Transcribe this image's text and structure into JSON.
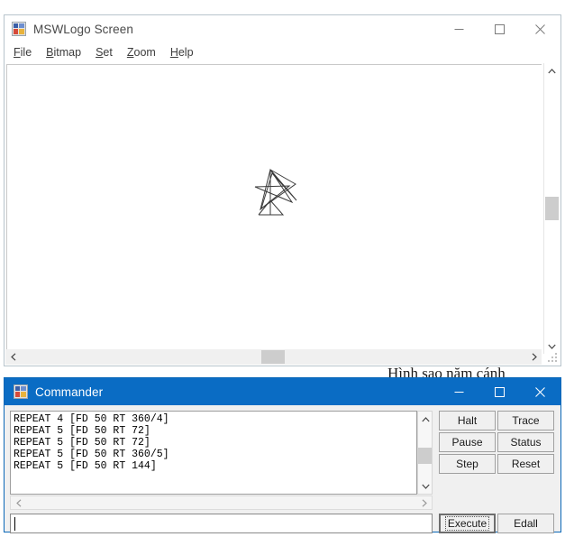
{
  "main_window": {
    "icon": "mswlogo-icon",
    "title": "MSWLogo Screen",
    "menu": [
      {
        "accel": "F",
        "rest": "ile",
        "name": "file"
      },
      {
        "accel": "B",
        "rest": "itmap",
        "name": "bitmap"
      },
      {
        "accel": "S",
        "rest": "et",
        "name": "set"
      },
      {
        "accel": "Z",
        "rest": "oom",
        "name": "zoom"
      },
      {
        "accel": "H",
        "rest": "elp",
        "name": "help"
      }
    ],
    "controls": {
      "minimize": "minimize-icon",
      "maximize": "maximize-icon",
      "close": "close-icon"
    }
  },
  "background_note": "Hình sao năm cánh",
  "commander": {
    "icon": "mswlogo-icon",
    "title": "Commander",
    "controls": {
      "minimize": "minimize-icon",
      "maximize": "maximize-icon",
      "close": "close-icon"
    },
    "history": "REPEAT 4 [FD 50 RT 360/4]\nREPEAT 5 [FD 50 RT 72]\nREPEAT 5 [FD 50 RT 72]\nREPEAT 5 [FD 50 RT 360/5]\nREPEAT 5 [FD 50 RT 144]",
    "history_lines": [
      "REPEAT 4 [FD 50 RT 360/4]",
      "REPEAT 5 [FD 50 RT 72]",
      "REPEAT 5 [FD 50 RT 72]",
      "REPEAT 5 [FD 50 RT 360/5]",
      "REPEAT 5 [FD 50 RT 144]"
    ],
    "input": {
      "value": "",
      "placeholder": ""
    },
    "buttons": {
      "halt": "Halt",
      "trace": "Trace",
      "pause": "Pause",
      "status": "Status",
      "step": "Step",
      "reset": "Reset",
      "execute": "Execute",
      "edall": "Edall"
    }
  },
  "colors": {
    "accent_titlebar": "#0a6cc4",
    "window_border": "#b8c4cc",
    "button_face": "#f0f0f0",
    "ink": "#3c3c3c"
  },
  "scrollbars": {
    "main_vertical_thumb_pct": 46,
    "main_horizontal_thumb_pct": 48,
    "commander_vertical_thumb_pct": 45
  }
}
